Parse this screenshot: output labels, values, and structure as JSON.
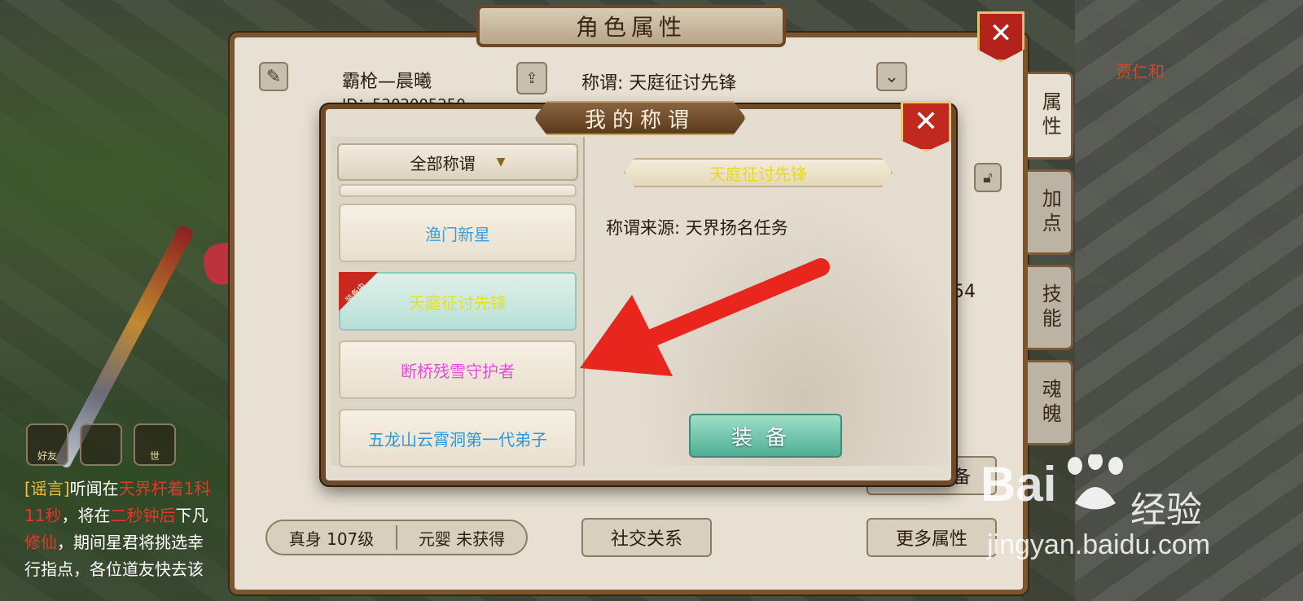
{
  "background": {
    "npc_name": "贾仁和"
  },
  "outer_panel": {
    "title": "角色属性",
    "close_glyph": "✕",
    "character_name": "霸枪—晨曦",
    "character_id_partial": "ID：5202005250",
    "share_label": "分享",
    "title_prefix_label": "称谓: 天庭征讨先锋",
    "partial_stat": "54",
    "side_tabs": [
      {
        "label": "属性",
        "active": true
      },
      {
        "label": "加点",
        "active": false
      },
      {
        "label": "技能",
        "active": false
      },
      {
        "label": "魂魄",
        "active": false
      }
    ],
    "realm": {
      "true_body": "真身 107级",
      "nascent_soul": "元婴 未获得"
    },
    "social_button": "社交关系",
    "more_attributes_button": "更多属性",
    "equip_partial_button": "备"
  },
  "chat": {
    "icons": [
      "好友",
      "",
      "世"
    ],
    "lines": [
      {
        "tag": "[谣言]",
        "text": "听闻在",
        "red": "天界杆着1科"
      },
      {
        "red_prefix": "11秒",
        "text": "，将在",
        "red": "二秒钟后",
        "text2": "下凡"
      },
      {
        "red_prefix": "修仙",
        "text": "，期间星君将挑选幸"
      },
      {
        "text": "行指点，各位道友快去该"
      }
    ]
  },
  "modal": {
    "title": "我的称谓",
    "close_glyph": "✕",
    "filter_label": "全部称谓",
    "filter_arrow": "▼",
    "equipped_tag": "装备中",
    "list": [
      {
        "label": "渔门新星",
        "color": "#3aa0d8"
      },
      {
        "label": "天庭征讨先锋",
        "color": "#e8e020",
        "equipped": true
      },
      {
        "label": "断桥残雪守护者",
        "color": "#e050d8"
      },
      {
        "label": "五龙山云霄洞第一代弟子",
        "color": "#2a98d8"
      }
    ],
    "detail": {
      "selected_title": "天庭征讨先锋",
      "source_text": "称谓来源: 天界扬名任务"
    },
    "equip_button": "装备"
  },
  "watermark": {
    "brand": "Bai",
    "brand_zh": "经验",
    "url": "jingyan.baidu.com"
  }
}
